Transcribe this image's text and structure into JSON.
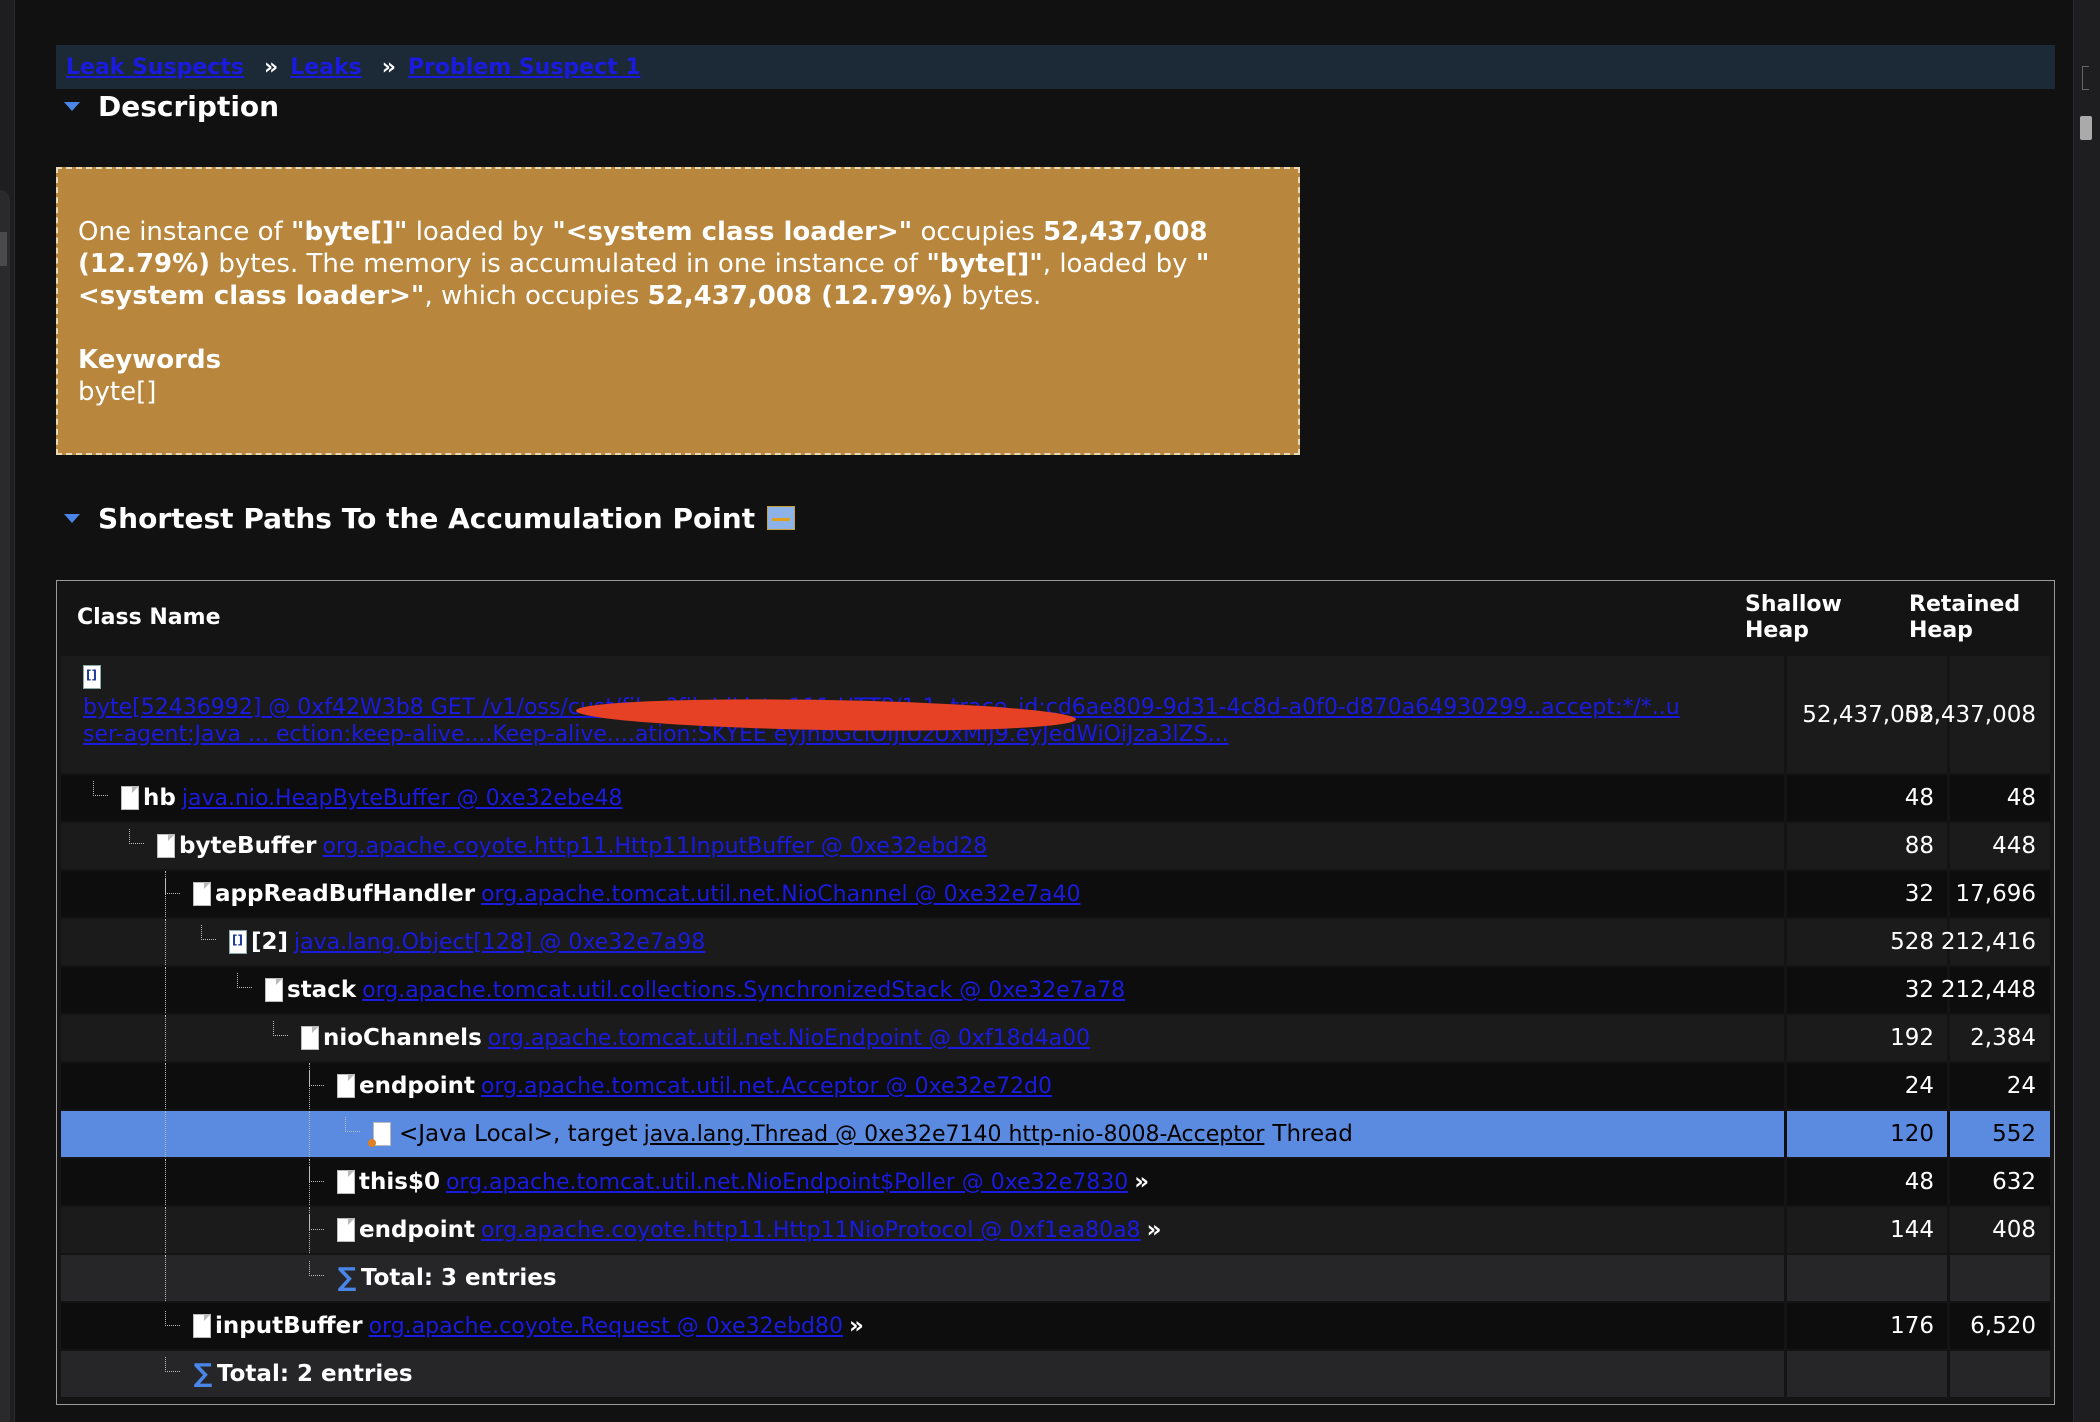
{
  "breadcrumb": {
    "items": [
      "Leak Suspects",
      "Leaks",
      "Problem Suspect 1"
    ],
    "separator": "»"
  },
  "description": {
    "heading": "Description",
    "text": {
      "p1": "One instance of ",
      "b1": "\"byte[]\"",
      "p2": " loaded by ",
      "b2": "\"<system class loader>\"",
      "p3": " occupies ",
      "b3": "52,437,008 (12.79%)",
      "p4": " bytes. The memory is accumulated in one instance of ",
      "b4": "\"byte[]\"",
      "p5": ", loaded by ",
      "b5": "\"<system class loader>\"",
      "p6": ", which occupies ",
      "b6": "52,437,008 (12.79%)",
      "p7": " bytes."
    },
    "keywords_title": "Keywords",
    "keywords_value": "byte[]"
  },
  "paths": {
    "heading": "Shortest Paths To the Accumulation Point",
    "columns": {
      "class_name": "Class Name",
      "shallow": "Shallow Heap",
      "retained": "Retained Heap"
    },
    "root": {
      "link": "byte[52436992] @ 0xf42W3b8 GET /v1/oss/cust/files?fileIdList=111 HTTP/1.1..trace_id:cd6ae809-9d31-4c8d-a0f0-d870a64930299..accept:*/*..user-agent:Java ... ection:keep-alive....Keep-alive....ation:SKYEE eyJhbGciOiJIUzUxMiJ9.eyJedWiOiJza3lZS...",
      "shallow": "52,437,008",
      "retained": "52,437,008"
    },
    "rows": [
      {
        "field": "hb",
        "link": "java.nio.HeapByteBuffer @ 0xe32ebe48",
        "more": "",
        "shallow": "48",
        "retained": "48"
      },
      {
        "field": "byteBuffer",
        "link": "org.apache.coyote.http11.Http11InputBuffer @ 0xe32ebd28",
        "more": "",
        "shallow": "88",
        "retained": "448"
      },
      {
        "field": "appReadBufHandler",
        "link": "org.apache.tomcat.util.net.NioChannel @ 0xe32e7a40",
        "more": "",
        "shallow": "32",
        "retained": "17,696"
      },
      {
        "field": "[2]",
        "link": "java.lang.Object[128] @ 0xe32e7a98",
        "more": "",
        "shallow": "528",
        "retained": "212,416"
      },
      {
        "field": "stack",
        "link": "org.apache.tomcat.util.collections.SynchronizedStack @ 0xe32e7a78",
        "more": "",
        "shallow": "32",
        "retained": "212,448"
      },
      {
        "field": "nioChannels",
        "link": "org.apache.tomcat.util.net.NioEndpoint @ 0xf18d4a00",
        "more": "",
        "shallow": "192",
        "retained": "2,384"
      },
      {
        "field": "endpoint",
        "link": "org.apache.tomcat.util.net.Acceptor @ 0xe32e72d0",
        "more": "",
        "shallow": "24",
        "retained": "24"
      },
      {
        "field": "<Java Local>, target",
        "link": "java.lang.Thread @ 0xe32e7140 http-nio-8008-Acceptor",
        "more": "Thread",
        "shallow": "120",
        "retained": "552"
      },
      {
        "field": "this$0",
        "link": "org.apache.tomcat.util.net.NioEndpoint$Poller @ 0xe32e7830",
        "more": "»",
        "shallow": "48",
        "retained": "632"
      },
      {
        "field": "endpoint",
        "link": "org.apache.coyote.http11.Http11NioProtocol @ 0xf1ea80a8",
        "more": "»",
        "shallow": "144",
        "retained": "408"
      },
      {
        "field": "Total: 3 entries",
        "link": "",
        "more": "",
        "shallow": "",
        "retained": ""
      },
      {
        "field": "inputBuffer",
        "link": "org.apache.coyote.Request @ 0xe32ebd80",
        "more": "»",
        "shallow": "176",
        "retained": "6,520"
      },
      {
        "field": "Total: 2 entries",
        "link": "",
        "more": "",
        "shallow": "",
        "retained": ""
      }
    ]
  },
  "colors": {
    "description_bg": "#b8863c",
    "selected_row": "#5b8be0",
    "link": "#1a1ae0",
    "redaction": "#e64125"
  }
}
